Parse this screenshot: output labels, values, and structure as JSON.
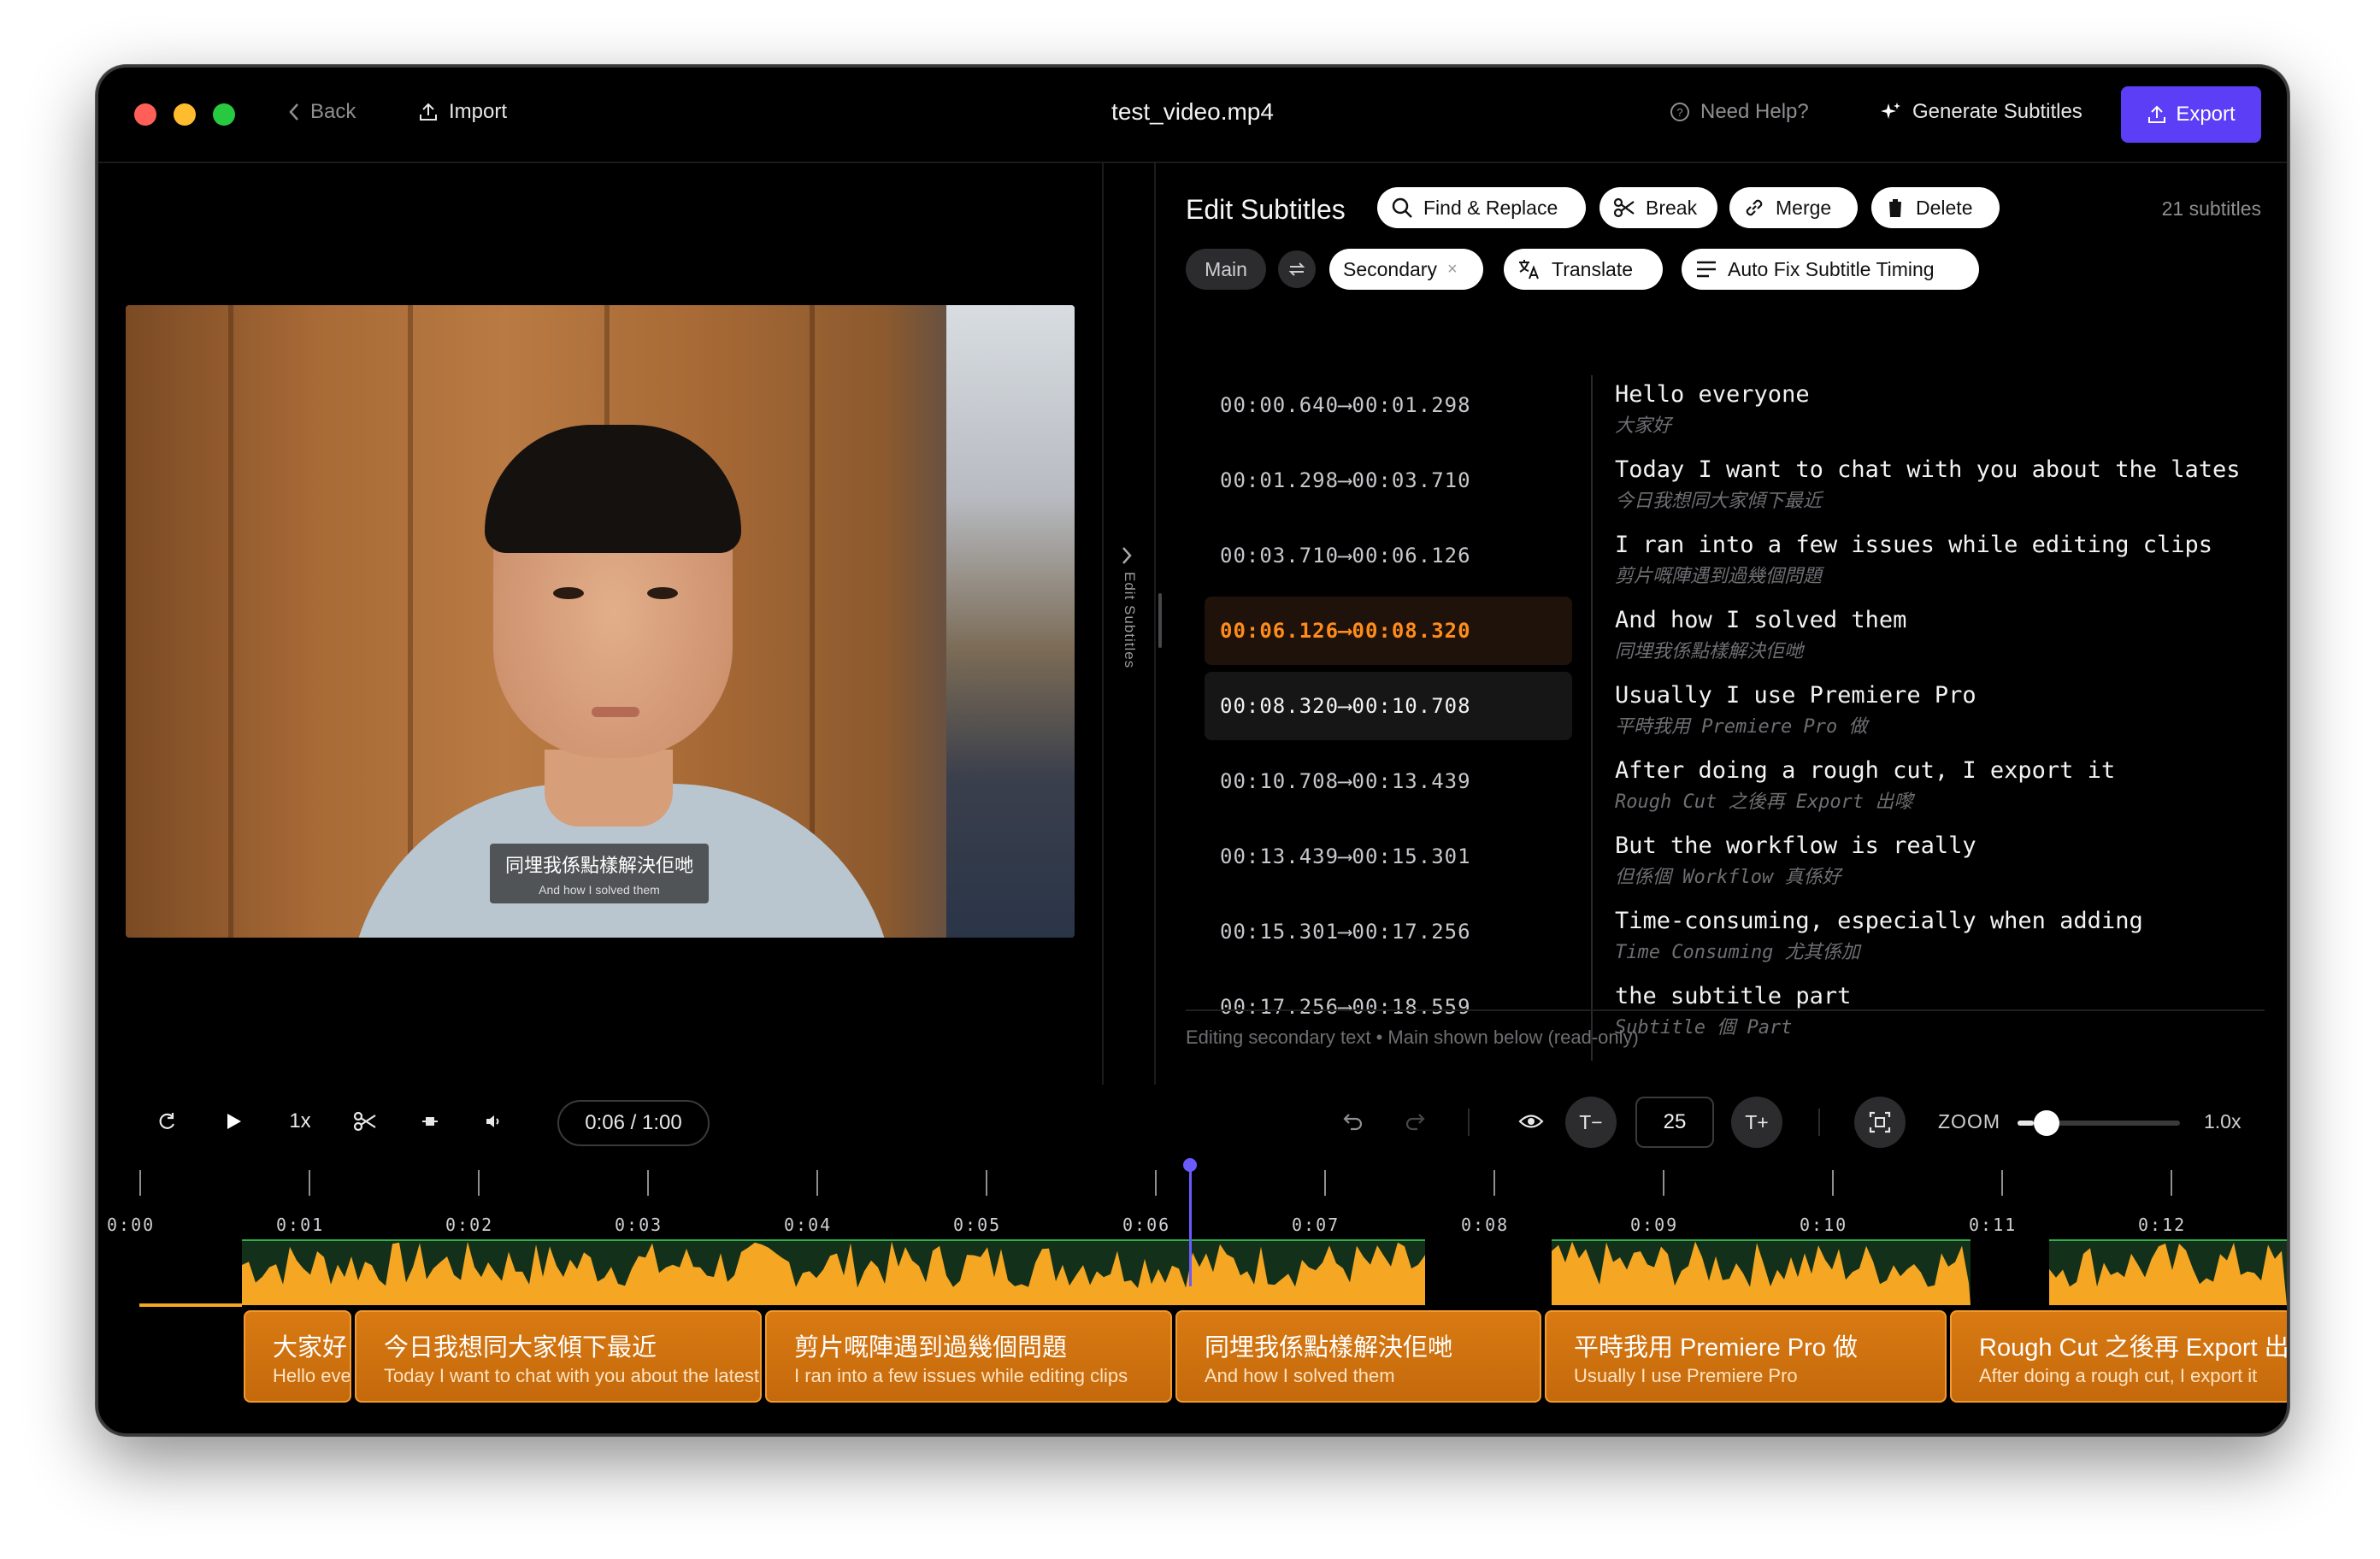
{
  "window": {
    "title": "test_video.mp4"
  },
  "titlebar": {
    "back_label": "Back",
    "import_label": "Import",
    "help_label": "Need Help?",
    "generate_label": "Generate Subtitles",
    "export_label": "Export"
  },
  "video": {
    "subtitle_main": "同埋我係點樣解決佢哋",
    "subtitle_secondary": "And how I solved them"
  },
  "side_toggle": {
    "label": "Edit Subtitles"
  },
  "editor": {
    "title": "Edit Subtitles",
    "buttons": {
      "find_replace": "Find & Replace",
      "break": "Break",
      "merge": "Merge",
      "delete": "Delete"
    },
    "count": "21 subtitles",
    "tracks": {
      "main": "Main",
      "secondary": "Secondary",
      "translate": "Translate",
      "auto_fix": "Auto Fix Subtitle Timing"
    },
    "rows": [
      {
        "start": "00:00.640",
        "end": "00:01.298",
        "main": "Hello everyone",
        "secondary": "大家好"
      },
      {
        "start": "00:01.298",
        "end": "00:03.710",
        "main": "Today I want to chat with you about the lates",
        "secondary": "今日我想同大家傾下最近"
      },
      {
        "start": "00:03.710",
        "end": "00:06.126",
        "main": "I ran into a few issues while editing clips",
        "secondary": "剪片嘅陣遇到過幾個問題"
      },
      {
        "start": "00:06.126",
        "end": "00:08.320",
        "main": "And how I solved them",
        "secondary": "同埋我係點樣解決佢哋"
      },
      {
        "start": "00:08.320",
        "end": "00:10.708",
        "main": "Usually I use Premiere Pro",
        "secondary": "平時我用 Premiere Pro 做"
      },
      {
        "start": "00:10.708",
        "end": "00:13.439",
        "main": "After doing a rough cut, I export it",
        "secondary": "Rough Cut 之後再 Export 出嚟"
      },
      {
        "start": "00:13.439",
        "end": "00:15.301",
        "main": "But the workflow is really",
        "secondary": "但係個 Workflow 真係好"
      },
      {
        "start": "00:15.301",
        "end": "00:17.256",
        "main": "Time-consuming, especially when adding",
        "secondary": "Time Consuming 尤其係加"
      },
      {
        "start": "00:17.256",
        "end": "00:18.559",
        "main": "the subtitle part",
        "secondary": "Subtitle 個 Part"
      }
    ],
    "arrow": "⟶",
    "hint": "Editing secondary text • Main shown below (read-only)"
  },
  "toolbar": {
    "speed": "1x",
    "time": "0:06 / 1:00",
    "font_minus": "T−",
    "font_size": "25",
    "font_plus": "T+",
    "zoom_label": "ZOOM",
    "zoom_value": "1.0x",
    "zoom_level": 0.1
  },
  "timeline": {
    "labels": [
      "0:00",
      "0:01",
      "0:02",
      "0:03",
      "0:04",
      "0:05",
      "0:06",
      "0:07",
      "0:08",
      "0:09",
      "0:10",
      "0:11",
      "0:12"
    ],
    "clips": [
      {
        "main": "大家好",
        "secondary": "Hello everyone"
      },
      {
        "main": "今日我想同大家傾下最近",
        "secondary": "Today I want to chat with you about the latest"
      },
      {
        "main": "剪片嘅陣遇到過幾個問題",
        "secondary": "I ran into a few issues while editing clips"
      },
      {
        "main": "同埋我係點樣解決佢哋",
        "secondary": "And how I solved them"
      },
      {
        "main": "平時我用 Premiere Pro 做",
        "secondary": "Usually I use Premiere Pro"
      },
      {
        "main": "Rough Cut 之後再 Export 出嚟",
        "secondary": "After doing a rough cut, I export it"
      }
    ]
  },
  "colors": {
    "accent": "#5b3ef5",
    "active": "#ff8c1a",
    "clip": "#d97a12",
    "playhead": "#6a5bff",
    "wave": "#f5a623"
  }
}
